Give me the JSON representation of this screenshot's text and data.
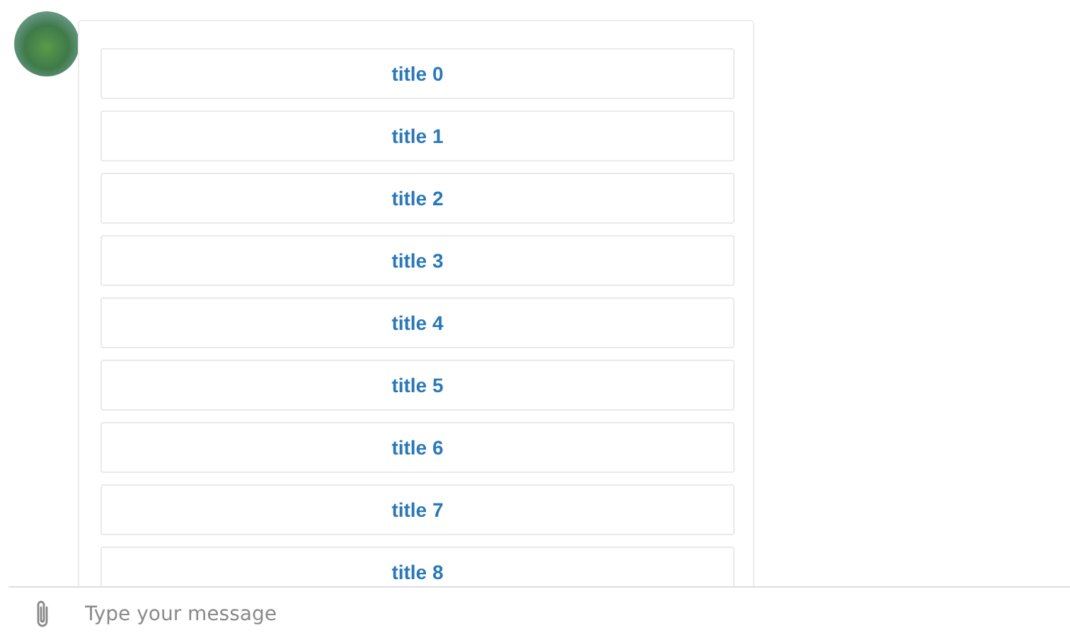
{
  "messages": [
    {
      "buttons": [
        {
          "title": "title 0"
        },
        {
          "title": "title 1"
        },
        {
          "title": "title 2"
        },
        {
          "title": "title 3"
        },
        {
          "title": "title 4"
        },
        {
          "title": "title 5"
        },
        {
          "title": "title 6"
        },
        {
          "title": "title 7"
        },
        {
          "title": "title 8"
        }
      ]
    }
  ],
  "composer": {
    "placeholder": "Type your message"
  }
}
